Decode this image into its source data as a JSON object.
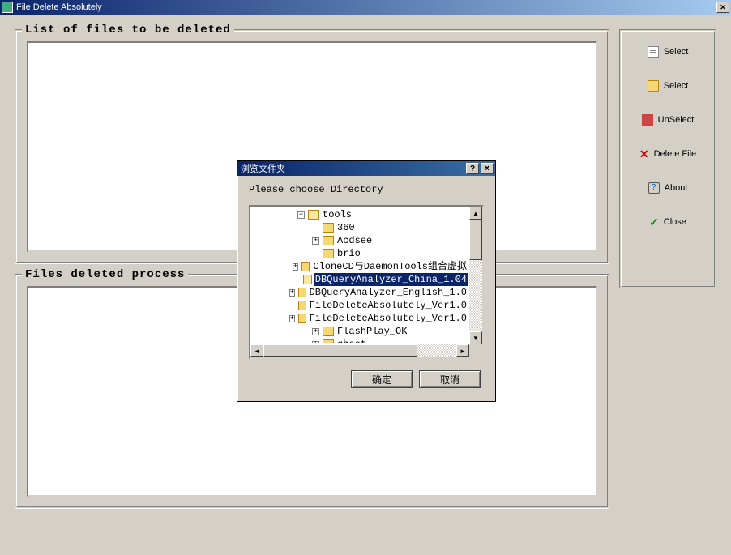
{
  "window": {
    "title": "File Delete Absolutely"
  },
  "groups": {
    "list_title": "List of files to be deleted",
    "process_title": "Files deleted process"
  },
  "panel": {
    "select_file": "Select",
    "select_folder": "Select",
    "unselect": "UnSelect",
    "delete_file": "Delete File",
    "about": "About",
    "close": "Close"
  },
  "dialog": {
    "title": "浏览文件夹",
    "prompt": "Please choose Directory",
    "ok": "确定",
    "cancel": "取消",
    "tree": [
      {
        "level": 0,
        "expander": "-",
        "icon": "open",
        "label": "tools",
        "selected": false
      },
      {
        "level": 1,
        "expander": "",
        "icon": "closed",
        "label": "360",
        "selected": false
      },
      {
        "level": 1,
        "expander": "+",
        "icon": "closed",
        "label": "Acdsee",
        "selected": false
      },
      {
        "level": 1,
        "expander": "",
        "icon": "closed",
        "label": "brio",
        "selected": false
      },
      {
        "level": 1,
        "expander": "+",
        "icon": "closed",
        "label": "CloneCD与DaemonTools组合虚拟",
        "selected": false
      },
      {
        "level": 1,
        "expander": "",
        "icon": "open",
        "label": "DBQueryAnalyzer_China_1.04",
        "selected": true
      },
      {
        "level": 1,
        "expander": "+",
        "icon": "closed",
        "label": "DBQueryAnalyzer_English_1.0",
        "selected": false
      },
      {
        "level": 1,
        "expander": "",
        "icon": "closed",
        "label": "FileDeleteAbsolutely_Ver1.0",
        "selected": false
      },
      {
        "level": 1,
        "expander": "+",
        "icon": "closed",
        "label": "FileDeleteAbsolutely_Ver1.0",
        "selected": false
      },
      {
        "level": 1,
        "expander": "+",
        "icon": "closed",
        "label": "FlashPlay_OK",
        "selected": false
      },
      {
        "level": 1,
        "expander": "+",
        "icon": "closed",
        "label": "ghost",
        "selected": false
      }
    ]
  }
}
